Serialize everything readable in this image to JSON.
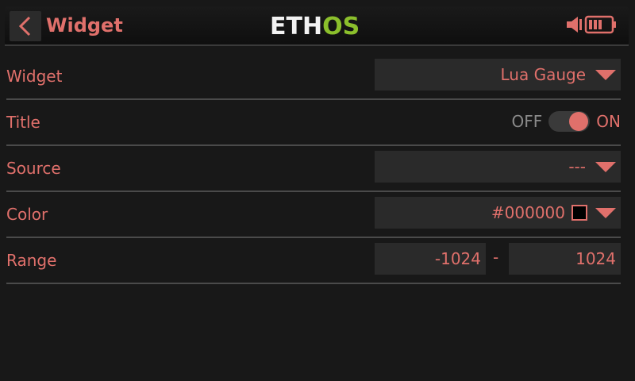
{
  "header": {
    "title": "Widget",
    "logo_left": "ETH",
    "logo_right": "OS"
  },
  "rows": {
    "widget": {
      "label": "Widget",
      "value": "Lua Gauge"
    },
    "title": {
      "label": "Title",
      "off_label": "OFF",
      "on_label": "ON",
      "state": "on"
    },
    "source": {
      "label": "Source",
      "value": "---"
    },
    "color": {
      "label": "Color",
      "value": "#000000",
      "swatch_color": "#000000"
    },
    "range": {
      "label": "Range",
      "min": "-1024",
      "separator": "-",
      "max": "1024"
    }
  },
  "colors": {
    "accent": "#e0706b",
    "logo_green": "#8bbf2c",
    "background": "#181818",
    "field_bg": "#2a2a2a"
  },
  "icons": [
    "chevron-left-icon",
    "speaker-icon",
    "battery-icon",
    "caret-down-icon"
  ]
}
